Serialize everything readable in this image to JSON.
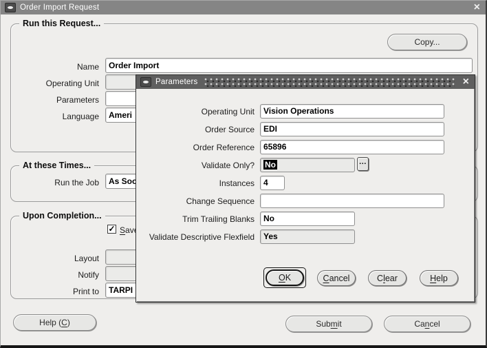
{
  "colors": {
    "window_bg": "#efeeec",
    "titlebar_main_bg": "#858585",
    "titlebar_dialog_bg": "#5f5f5f",
    "titlebar_text": "#ffffff",
    "field_disabled_bg": "#ebebe9",
    "highlight_bg": "#000000",
    "highlight_text": "#ffffff"
  },
  "window": {
    "title": "Order Import Request",
    "close_glyph": "×",
    "run_request_group": {
      "legend": "Run this Request...",
      "copy_button_label": "Copy...",
      "fields": {
        "name": {
          "label": "Name",
          "value": "Order Import"
        },
        "operating_unit": {
          "label": "Operating Unit",
          "value": ""
        },
        "parameters": {
          "label": "Parameters",
          "value": ""
        },
        "language": {
          "label": "Language",
          "value": "Ameri"
        }
      }
    },
    "times_group": {
      "legend": "At these Times...",
      "fields": {
        "run_the_job": {
          "label": "Run the Job",
          "value": "As Soo"
        }
      }
    },
    "completion_group": {
      "legend": "Upon Completion...",
      "save_checkbox": {
        "checked_glyph": "✓",
        "pre": "",
        "key": "S",
        "post": "ave"
      },
      "fields": {
        "layout": {
          "label": "Layout",
          "value": ""
        },
        "notify": {
          "label": "Notify",
          "value": ""
        },
        "print_to": {
          "label": "Print to",
          "value": "TARPI"
        }
      }
    },
    "buttons": {
      "help": {
        "pre": "Help (",
        "key": "C",
        "post": ")"
      },
      "submit": {
        "pre": "Sub",
        "key": "m",
        "post": "it"
      },
      "cancel": {
        "pre": "Ca",
        "key": "n",
        "post": "cel"
      }
    }
  },
  "dialog": {
    "title": "Parameters",
    "close_glyph": "×",
    "lov_button_glyph": "...",
    "fields": [
      {
        "label": "Operating Unit",
        "value": "Vision Operations"
      },
      {
        "label": "Order Source",
        "value": "EDI"
      },
      {
        "label": "Order Reference",
        "value": "65896"
      },
      {
        "label": "Validate Only?",
        "value": "No"
      },
      {
        "label": "Instances",
        "value": "4"
      },
      {
        "label": "Change Sequence",
        "value": ""
      },
      {
        "label": "Trim Trailing Blanks",
        "value": "No"
      },
      {
        "label": "Validate Descriptive Flexfield",
        "value": "Yes"
      }
    ],
    "buttons": {
      "ok": {
        "pre": "",
        "key": "O",
        "post": "K"
      },
      "cancel": {
        "pre": "",
        "key": "C",
        "post": "ancel"
      },
      "clear": {
        "pre": "C",
        "key": "l",
        "post": "ear"
      },
      "help": {
        "pre": "",
        "key": "H",
        "post": "elp"
      }
    }
  }
}
